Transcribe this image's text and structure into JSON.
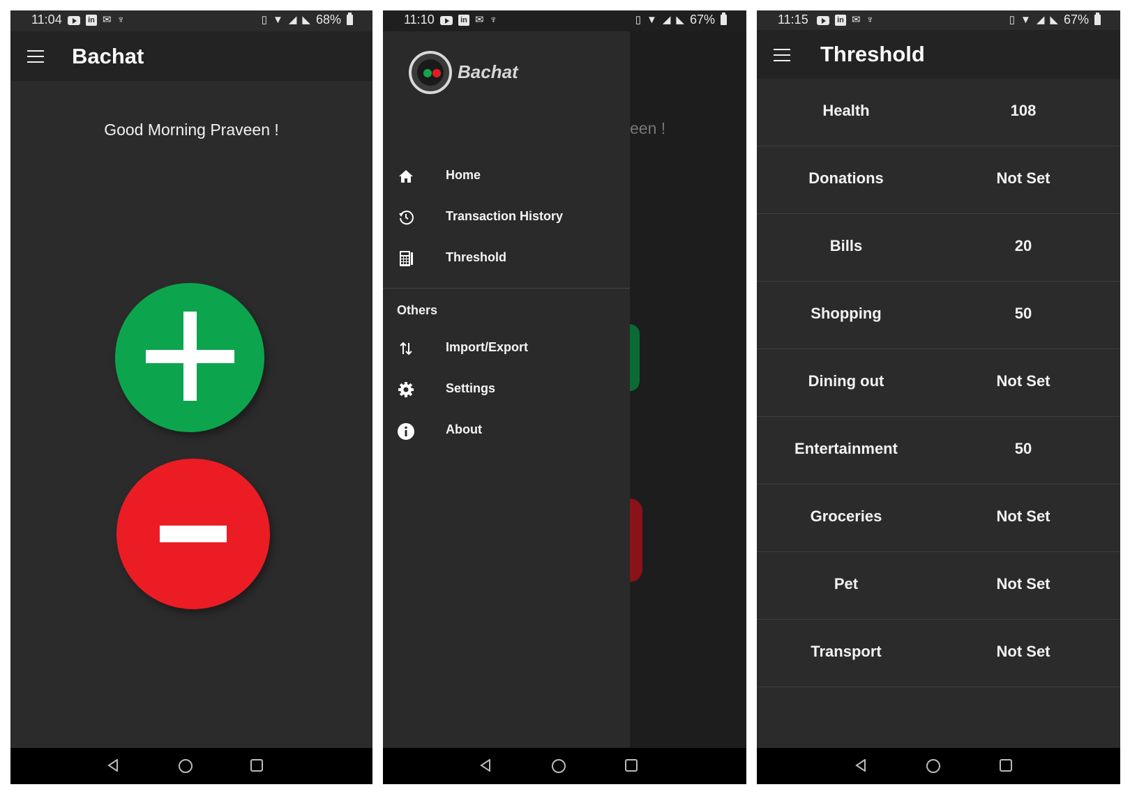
{
  "screen1": {
    "status": {
      "time": "11:04",
      "battery": "68%"
    },
    "title": "Bachat",
    "greeting": "Good Morning Praveen !"
  },
  "screen2": {
    "status": {
      "time": "11:10",
      "battery": "67%"
    },
    "brand": "Bachat",
    "background_greeting_fragment": "een !",
    "menu": [
      {
        "label": "Home",
        "icon": "home-icon"
      },
      {
        "label": "Transaction History",
        "icon": "history-icon"
      },
      {
        "label": "Threshold",
        "icon": "calculator-icon"
      }
    ],
    "section_title": "Others",
    "others": [
      {
        "label": "Import/Export",
        "icon": "import-export-icon"
      },
      {
        "label": "Settings",
        "icon": "gear-icon"
      },
      {
        "label": "About",
        "icon": "info-icon"
      }
    ]
  },
  "screen3": {
    "status": {
      "time": "11:15",
      "battery": "67%"
    },
    "title": "Threshold",
    "rows": [
      {
        "category": "Health",
        "value": "108"
      },
      {
        "category": "Donations",
        "value": "Not Set"
      },
      {
        "category": "Bills",
        "value": "20"
      },
      {
        "category": "Shopping",
        "value": "50"
      },
      {
        "category": "Dining out",
        "value": "Not Set"
      },
      {
        "category": "Entertainment",
        "value": "50"
      },
      {
        "category": "Groceries",
        "value": "Not Set"
      },
      {
        "category": "Pet",
        "value": "Not Set"
      },
      {
        "category": "Transport",
        "value": "Not Set"
      }
    ]
  },
  "colors": {
    "background": "#2b2b2b",
    "appbar": "#232323",
    "add": "#0ca54d",
    "subtract": "#ec1c24"
  }
}
